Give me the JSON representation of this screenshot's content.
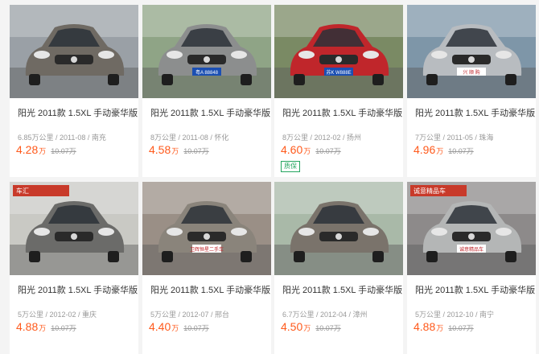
{
  "listings": [
    {
      "title": "阳光 2011款 1.5XL 手动豪华版",
      "meta": "6.85万公里 / 2011-08 / 南充",
      "price": "4.28",
      "unit": "万",
      "old_price": "10.07万",
      "badge": "",
      "car_color": "#6f6a63",
      "bg": "#9aa0a6"
    },
    {
      "title": "阳光 2011款 1.5XL 手动豪华版",
      "meta": "8万公里 / 2011-08 / 怀化",
      "price": "4.58",
      "unit": "万",
      "old_price": "10.07万",
      "badge": "",
      "car_color": "#8c8e8e",
      "bg": "#8fa486"
    },
    {
      "title": "阳光 2011款 1.5XL 手动豪华版",
      "meta": "8万公里 / 2012-02 / 扬州",
      "price": "4.60",
      "unit": "万",
      "old_price": "10.07万",
      "badge": "质保",
      "car_color": "#c0262b",
      "bg": "#7a8a64"
    },
    {
      "title": "阳光 2011款 1.5XL 手动豪华版",
      "meta": "7万公里 / 2011-05 / 珠海",
      "price": "4.96",
      "unit": "万",
      "old_price": "10.07万",
      "badge": "",
      "car_color": "#b8bcc0",
      "bg": "#7e96a8"
    },
    {
      "title": "阳光 2011款 1.5XL 手动豪华版",
      "meta": "5万公里 / 2012-02 / 重庆",
      "price": "4.88",
      "unit": "万",
      "old_price": "10.07万",
      "badge": "",
      "car_color": "#6b6b69",
      "bg": "#c9c9c4"
    },
    {
      "title": "阳光 2011款 1.5XL 手动豪华版",
      "meta": "5万公里 / 2012-07 / 邢台",
      "price": "4.40",
      "unit": "万",
      "old_price": "10.07万",
      "badge": "",
      "car_color": "#8a847b",
      "bg": "#9a8f86"
    },
    {
      "title": "阳光 2011款 1.5XL 手动豪华版",
      "meta": "6.7万公里 / 2012-04 / 漳州",
      "price": "4.50",
      "unit": "万",
      "old_price": "10.07万",
      "badge": "",
      "car_color": "#7a736b",
      "bg": "#a9b9a8"
    },
    {
      "title": "阳光 2011款 1.5XL 手动豪华版",
      "meta": "5万公里 / 2012-10 / 南宁",
      "price": "4.88",
      "unit": "万",
      "old_price": "10.07万",
      "badge": "",
      "car_color": "#b4b6b6",
      "bg": "#8d8a8a"
    }
  ],
  "plates": [
    "",
    "粤A 88848",
    "苏K W888E",
    "兴 顺 购",
    "",
    "卫辉恒星二手车",
    "",
    "诚意精品车"
  ],
  "signs": [
    "",
    "",
    "",
    "",
    "车汇",
    "",
    "",
    "诚意精品车"
  ]
}
